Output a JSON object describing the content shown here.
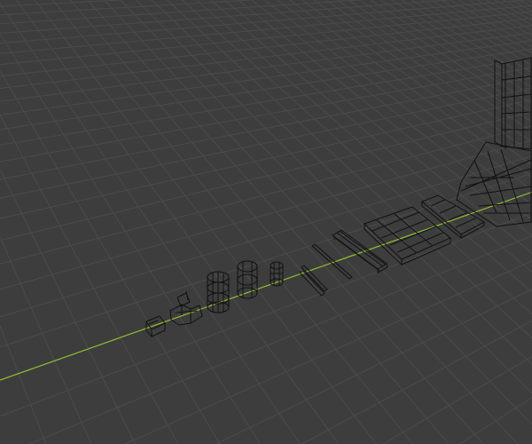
{
  "viewport": {
    "mode": "wireframe",
    "colors": {
      "background": "#3d3d3d",
      "grid": "#4b4b4b",
      "x_axis": "#8fbf2f",
      "wireframe": "#111111"
    }
  }
}
